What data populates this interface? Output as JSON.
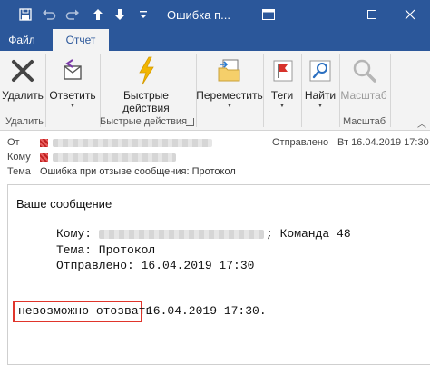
{
  "window": {
    "title": "Ошибка п...",
    "icons": [
      "save-icon",
      "undo-icon",
      "redo-icon",
      "up-arrow-icon",
      "down-arrow-icon",
      "more-icon",
      "restore-icon",
      "minimize-icon",
      "maximize-icon",
      "close-icon"
    ]
  },
  "tabs": [
    {
      "label": "Файл"
    },
    {
      "label": "Отчет"
    }
  ],
  "ribbon": {
    "delete": {
      "label": "Удалить"
    },
    "reply": {
      "label": "Ответить"
    },
    "quick_steps": {
      "label_line1": "Быстрые",
      "label_line2": "действия"
    },
    "move": {
      "label": "Переместить"
    },
    "tags": {
      "label": "Теги"
    },
    "find": {
      "label": "Найти"
    },
    "zoom": {
      "label": "Масштаб"
    },
    "groups": {
      "delete": "Удалить",
      "quick_steps": "Быстрые действия",
      "zoom": "Масштаб"
    }
  },
  "header": {
    "from_label": "От",
    "to_label": "Кому",
    "subject_label": "Тема",
    "subject": "Ошибка при отзыве сообщения: Протокол",
    "sent_label": "Отправлено",
    "sent_value": "Вт 16.04.2019 17:30"
  },
  "message": {
    "line1": "Ваше сообщение",
    "to_label": "Кому:",
    "to_suffix": "; Команда 48",
    "subject_line": "Тема:  Протокол",
    "sent_line": "Отправлено:  16.04.2019 17:30",
    "failed_text": "невозможно отозвать",
    "failed_time": "16.04.2019 17:30."
  },
  "colors": {
    "titlebar": "#2b579a",
    "ribbon_bg": "#f3f3f3",
    "highlight_border": "#e0352b"
  }
}
